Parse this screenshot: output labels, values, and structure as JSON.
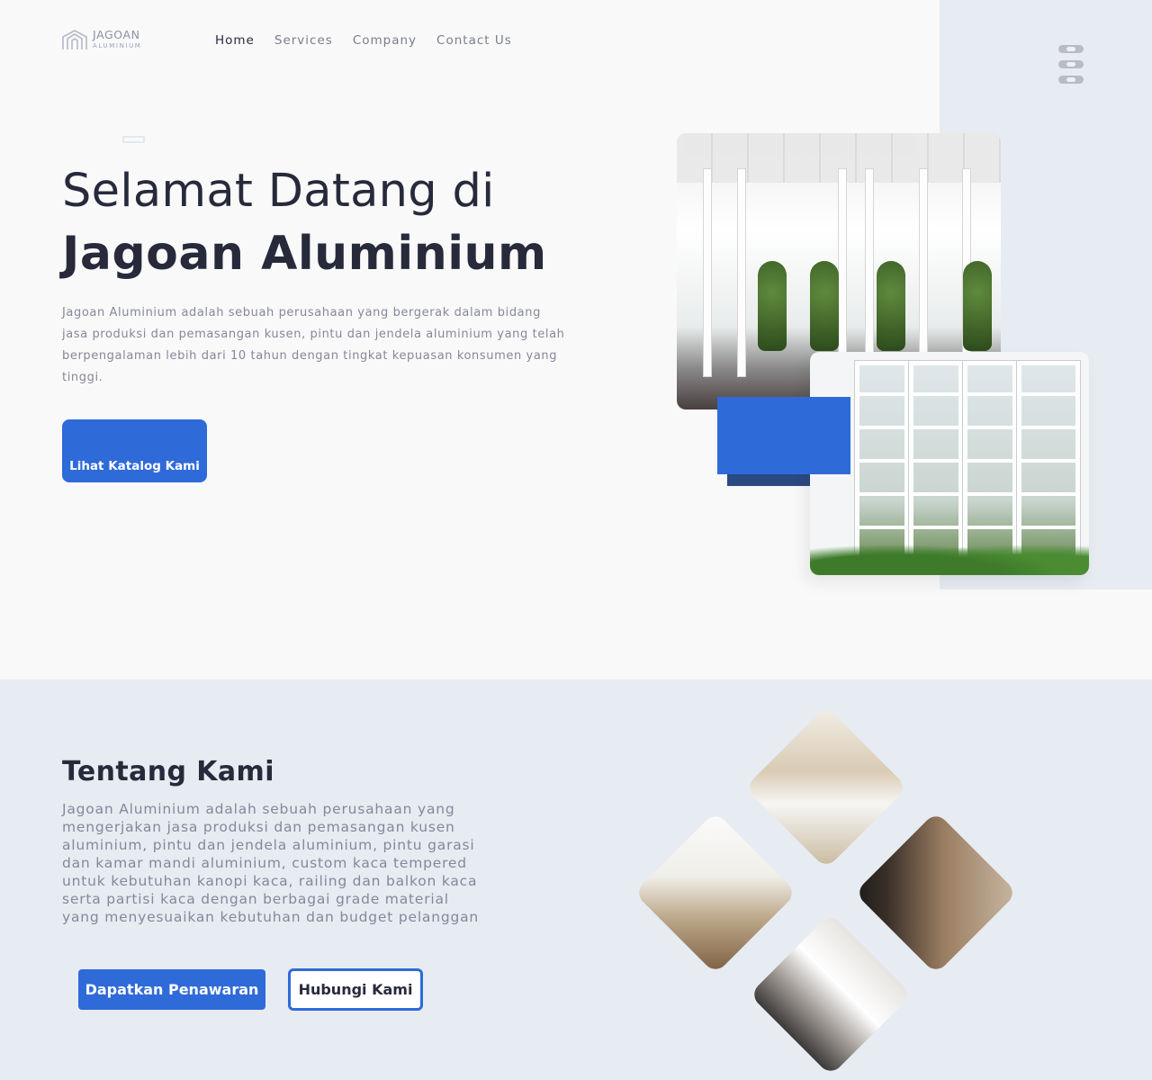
{
  "brand": {
    "name": "JAGOAN",
    "sub": "ALUMINIUM"
  },
  "nav": {
    "items": [
      {
        "label": "Home",
        "active": true
      },
      {
        "label": "Services",
        "active": false
      },
      {
        "label": "Company",
        "active": false
      },
      {
        "label": "Contact Us",
        "active": false
      }
    ]
  },
  "social": {
    "icons": [
      "instagram-icon",
      "whatsapp-icon",
      "youtube-icon"
    ]
  },
  "hero": {
    "title_line1": "Selamat Datang di",
    "title_line2": "Jagoan Aluminium",
    "description": "Jagoan Aluminium adalah sebuah perusahaan yang bergerak dalam bidang jasa produksi dan pemasangan kusen, pintu dan jendela aluminium yang telah berpengalaman lebih dari 10 tahun dengan tingkat kepuasan konsumen yang tinggi.",
    "cta_label": "Lihat Katalog Kami"
  },
  "about": {
    "title": "Tentang Kami",
    "description": "Jagoan Aluminium adalah sebuah perusahaan yang mengerjakan jasa produksi dan pemasangan kusen aluminium, pintu dan jendela aluminium, pintu garasi dan kamar mandi aluminium, custom kaca tempered untuk kebutuhan kanopi kaca, railing dan balkon kaca serta partisi kaca dengan berbagai grade material yang menyesuaikan kebutuhan dan budget pelanggan",
    "offer_label": "Dapatkan Penawaran",
    "contact_label": "Hubungi Kami"
  },
  "colors": {
    "primary": "#2f6ad9",
    "primary_dark": "#2b4a83",
    "text_dark": "#272a3b",
    "text_muted": "#85889a",
    "panel": "#e7ebf2"
  }
}
